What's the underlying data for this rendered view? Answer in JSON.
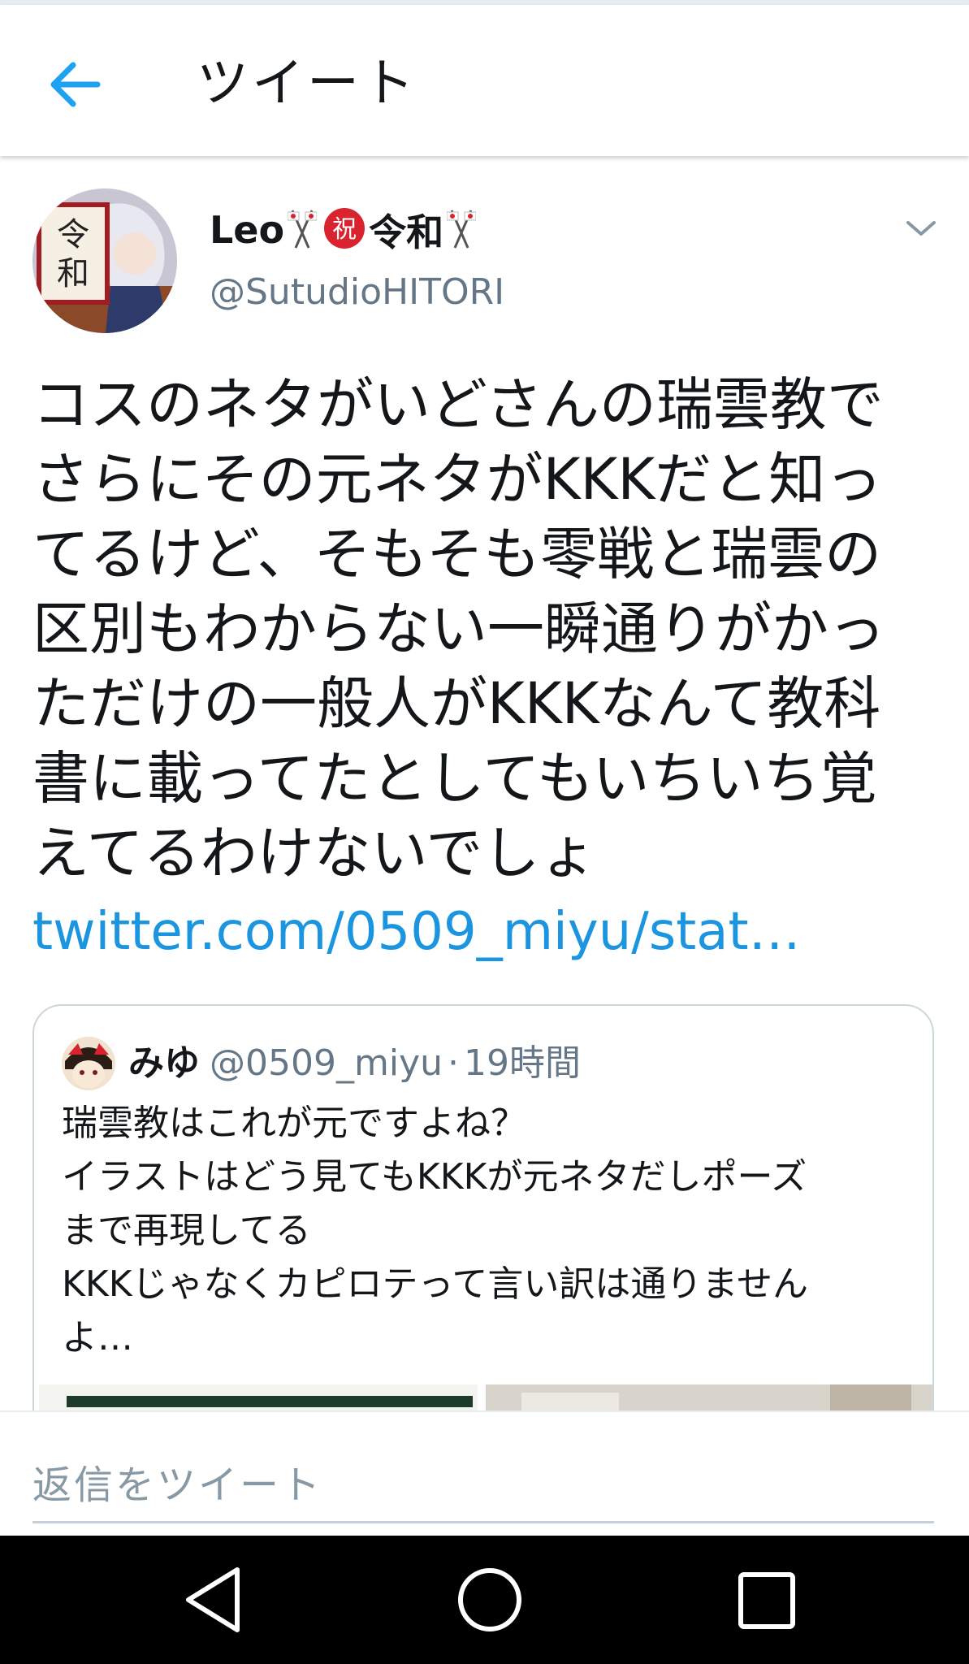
{
  "header": {
    "title": "ツイート"
  },
  "tweet": {
    "author_name": "Leo",
    "author_name_badge": "祝",
    "author_name_suffix": "令和",
    "author_handle": "@SutudioHITORI",
    "avatar_text": "令和",
    "text": "コスのネタがいどさんの瑞雲教で\nさらにその元ネタがKKKだと知っ\nてるけど、そもそも零戦と瑞雲の\n区別もわからない一瞬通りがかっ\nただけの一般人がKKKなんて教科\n書に載ってたとしてもいちいち覚\nえてるわけないでしょ",
    "link": "twitter.com/0509_miyu/stat…"
  },
  "quoted": {
    "name": "みゆ",
    "handle": "@0509_miyu",
    "separator": "·",
    "time": "19時間",
    "text": "瑞雲教はこれが元ですよね？\nイラストはどう見てもKKKが元ネタだしポーズ\nまで再現してる\nKKKじゃなくカピロテって言い訳は通りません\nよ…"
  },
  "reply": {
    "placeholder": "返信をツイート"
  },
  "colors": {
    "accent": "#1da1f2",
    "link": "#1b95e0",
    "secondary_text": "#657786",
    "badge_red": "#d9232f"
  },
  "icons": {
    "back": "arrow-left-icon",
    "caret": "chevron-down-icon",
    "flag": "crossed-flags-icon",
    "nav_back": "triangle-back-icon",
    "nav_home": "circle-home-icon",
    "nav_recents": "square-recents-icon"
  }
}
